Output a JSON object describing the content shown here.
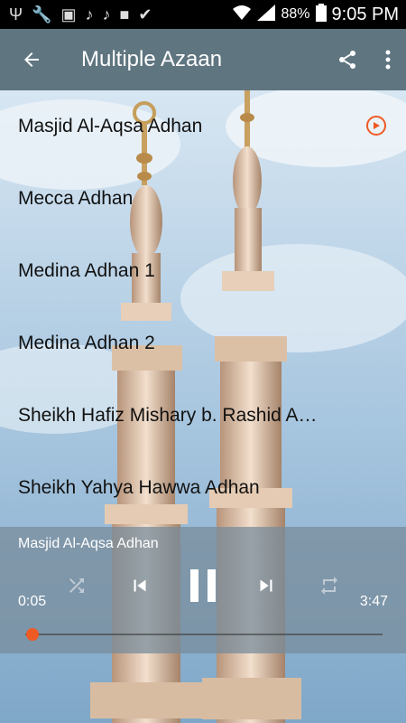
{
  "status_bar": {
    "battery": "88%",
    "time": "9:05 PM"
  },
  "app_bar": {
    "title": "Multiple Azaan"
  },
  "list": {
    "items": [
      {
        "label": "Masjid Al-Aqsa Adhan",
        "playing": true
      },
      {
        "label": "Mecca Adhan",
        "playing": false
      },
      {
        "label": "Medina Adhan 1",
        "playing": false
      },
      {
        "label": "Medina Adhan 2",
        "playing": false
      },
      {
        "label": "Sheikh Hafiz Mishary b. Rashid A…",
        "playing": false
      },
      {
        "label": "Sheikh Yahya Hawwa Adhan",
        "playing": false
      }
    ]
  },
  "player": {
    "now_playing": "Masjid Al-Aqsa Adhan",
    "elapsed": "0:05",
    "duration": "3:47",
    "progress_fraction": 0.02,
    "state": "playing"
  },
  "colors": {
    "app_bar": "#5f7580",
    "accent": "#ee5a24"
  },
  "icons": {
    "back": "arrow-left-icon",
    "share": "share-icon",
    "more": "more-vert-icon",
    "shuffle": "shuffle-icon",
    "previous": "skip-previous-icon",
    "pause": "pause-icon",
    "next": "skip-next-icon",
    "repeat": "repeat-icon"
  }
}
